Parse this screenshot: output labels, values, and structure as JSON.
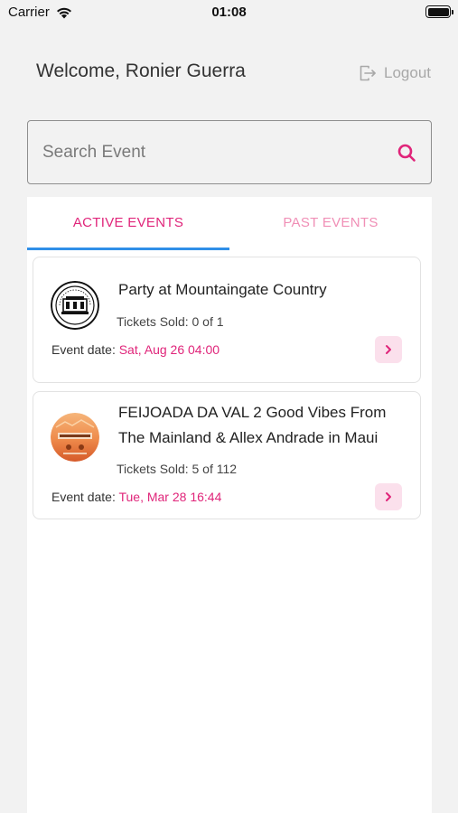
{
  "status_bar": {
    "carrier": "Carrier",
    "time": "01:08"
  },
  "header": {
    "welcome": "Welcome, Ronier Guerra",
    "logout_label": "Logout"
  },
  "search": {
    "placeholder": "Search Event",
    "value": ""
  },
  "tabs": [
    {
      "label": "ACTIVE EVENTS",
      "active": true
    },
    {
      "label": "PAST EVENTS",
      "active": false
    }
  ],
  "events": [
    {
      "title": "Party at Mountaingate Country",
      "tickets": "Tickets Sold: 0 of 1",
      "date_label": "Event date:",
      "date_value": "Sat,  Aug 26  04:00"
    },
    {
      "title": "FEIJOADA DA VAL 2 Good Vibes From The Mainland & Allex Andrade in Maui",
      "tickets": "Tickets Sold: 5 of 112",
      "date_label": "Event date:",
      "date_value": "Tue,  Mar 28  16:44"
    }
  ],
  "colors": {
    "accent": "#e0257a",
    "accent_light": "#f08fb6",
    "tab_indicator": "#2f8fe8",
    "chevron_bg": "#fbe0ec"
  }
}
